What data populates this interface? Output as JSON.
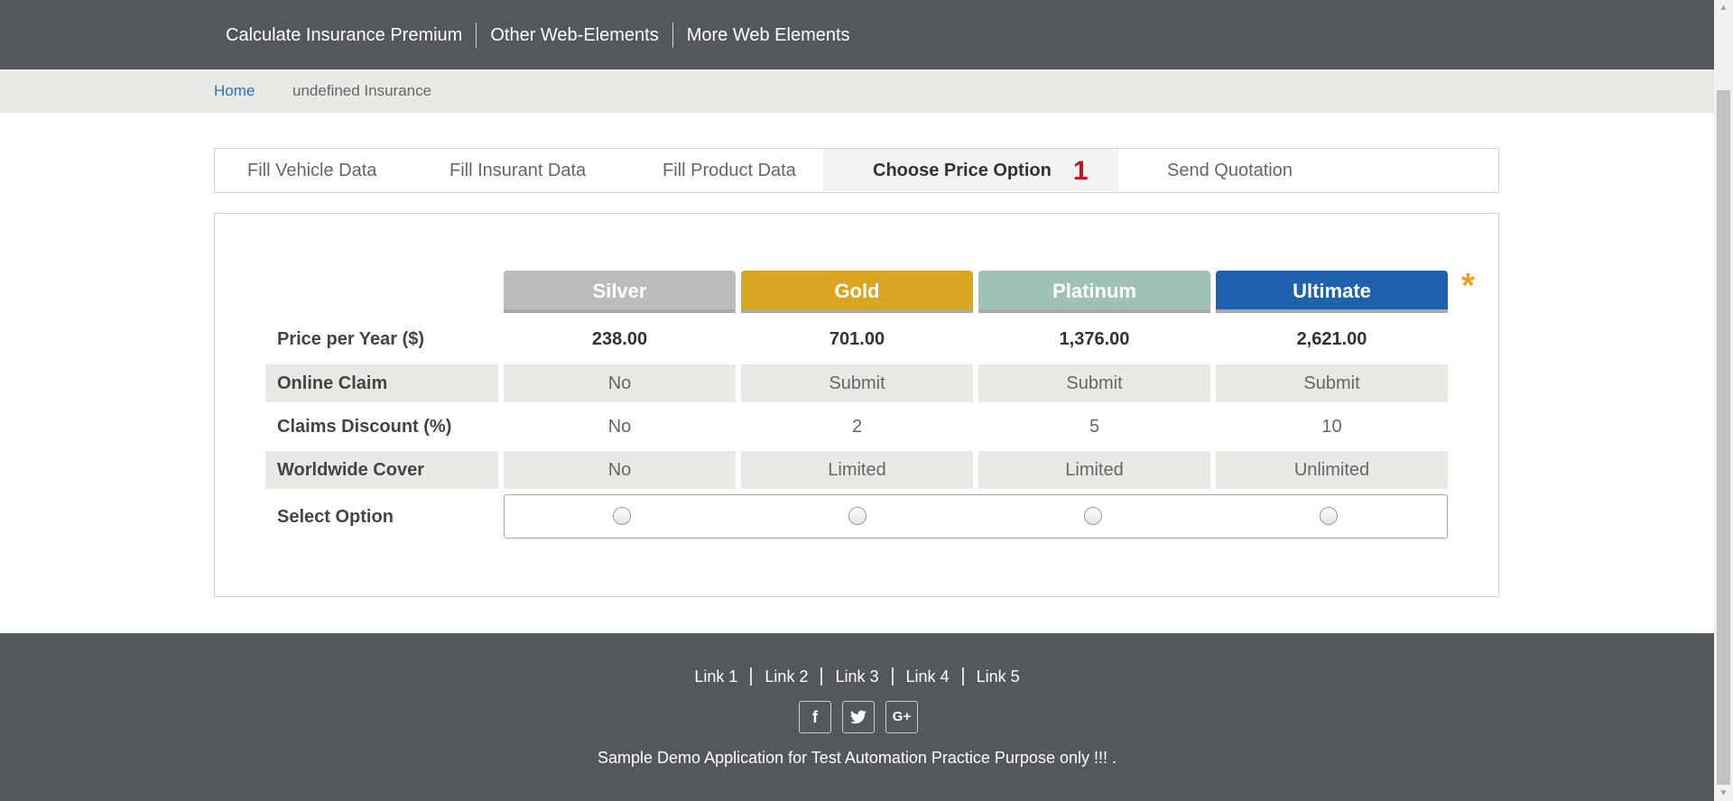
{
  "topnav": {
    "links": [
      "Calculate Insurance Premium",
      "Other Web-Elements",
      "More Web Elements"
    ]
  },
  "breadcrumb": {
    "home": "Home",
    "current": "undefined Insurance"
  },
  "tabs": [
    {
      "label": "Fill Vehicle Data"
    },
    {
      "label": "Fill Insurant Data"
    },
    {
      "label": "Fill Product Data"
    },
    {
      "label": "Choose Price Option",
      "badge": "1",
      "active": true
    },
    {
      "label": "Send Quotation"
    }
  ],
  "price_table": {
    "columns": [
      {
        "name": "Silver",
        "color": "#bcbcbc"
      },
      {
        "name": "Gold",
        "color": "#daa520"
      },
      {
        "name": "Platinum",
        "color": "#9fc2b5"
      },
      {
        "name": "Ultimate",
        "color": "#1f61ad"
      }
    ],
    "required_marker": "*",
    "rows": [
      {
        "label": "Price per Year ($)",
        "values": [
          "238.00",
          "701.00",
          "1,376.00",
          "2,621.00"
        ]
      },
      {
        "label": "Online Claim",
        "values": [
          "No",
          "Submit",
          "Submit",
          "Submit"
        ]
      },
      {
        "label": "Claims Discount (%)",
        "values": [
          "No",
          "2",
          "5",
          "10"
        ]
      },
      {
        "label": "Worldwide Cover",
        "values": [
          "No",
          "Limited",
          "Limited",
          "Unlimited"
        ]
      }
    ],
    "select_label": "Select Option",
    "selected": null
  },
  "footer": {
    "links": [
      "Link 1",
      "Link 2",
      "Link 3",
      "Link 4",
      "Link 5"
    ],
    "social": [
      {
        "icon": "facebook-icon",
        "glyph": "f"
      },
      {
        "icon": "twitter-icon",
        "glyph": "t"
      },
      {
        "icon": "google-plus-icon",
        "glyph": "G+"
      }
    ],
    "text": "Sample Demo Application for Test Automation Practice Purpose only !!! ."
  }
}
